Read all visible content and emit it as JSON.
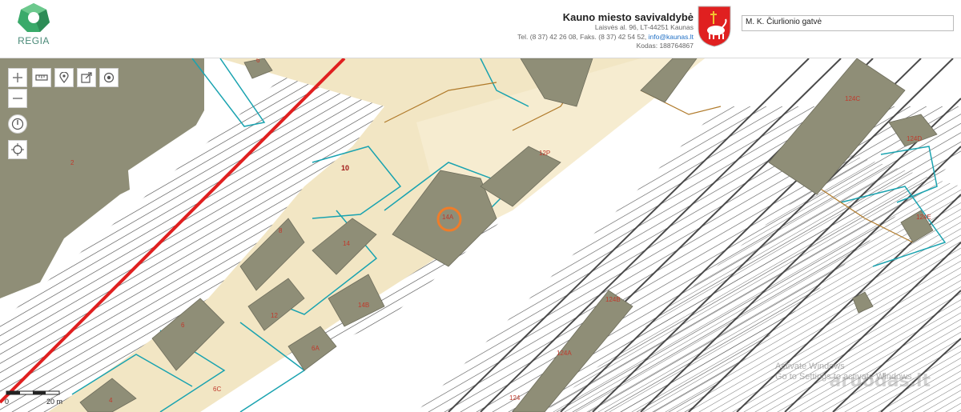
{
  "app": {
    "logo_text": "REGIA"
  },
  "municipality": {
    "name": "Kauno miesto savivaldybė",
    "address": "Laisvės al. 96, LT-44251 Kaunas",
    "contacts_prefix": "Tel. (8 37) 42 26 08, Faks. (8 37) 42 54 52, ",
    "email": "info@kaunas.lt",
    "code": "Kodas: 188764867"
  },
  "search": {
    "value": "M. K. Čiurlionio gatvė"
  },
  "map_controls": [
    "zoom-in",
    "zoom-out",
    "ruler",
    "pin",
    "export",
    "target",
    "power",
    "locate"
  ],
  "parcel_labels": {
    "p6": "6",
    "p2": "2",
    "p8": "8",
    "p10": "10",
    "p12": "12",
    "p14": "14",
    "p14A": "14A",
    "p14B": "14B",
    "p6A": "6A",
    "p6C": "6C",
    "p4": "4",
    "p124": "124",
    "p124A": "124A",
    "p124B": "124B",
    "p124C": "124C",
    "p124D": "124D",
    "p124E": "124E",
    "p12P": "12P"
  },
  "scale": {
    "zero": "0",
    "distance": "20 m"
  },
  "watermark": "aruodas.lt",
  "system_notice": {
    "line1": "Activate Windows",
    "line2": "Go to Settings to activate Windows."
  },
  "colors": {
    "parcel": "#f2e6c4",
    "building": "#8f8e77",
    "rail_line": "#4a4a4a",
    "red_line": "#e02020",
    "cyan_line": "#1aa3b0"
  }
}
